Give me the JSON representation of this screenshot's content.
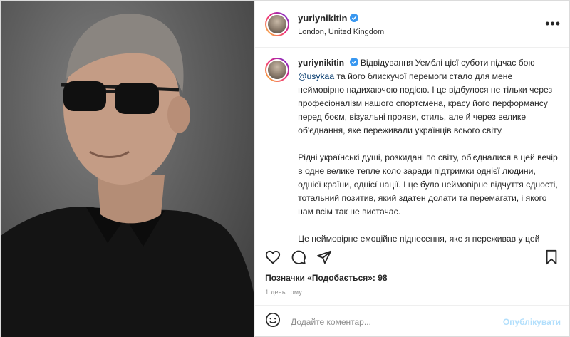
{
  "post": {
    "username": "yuriynikitin",
    "location": "London, United Kingdom",
    "more_label": "•••",
    "caption": {
      "text_1": "Відвідування Уемблі цієї суботи підчас бою",
      "mention": "@usykaa",
      "text_2": "та його блискучої перемоги стало для мене неймовірно надихаючою подією. І це відбулося не тільки через професіоналізм нашого спортсмена, красу його перформансу перед боєм, візуальні прояви, стиль, але й через велике об'єднання, яке переживали українців всього світу.",
      "para_2": "Рідні українські душі, розкидані по світу, об'єдналися в цей вечір в одне велике тепле коло заради підтримки однієї людини, однієї країни, однієї нації. І це було неймовірне відчуття єдності, тотальний позитив, який здатен долати та перемагати, і якого нам всім так не вистачає.",
      "para_3": "Це неймовірне емоційне піднесення, яке я переживав у цей вечір народило у мені велике бажання зробити наймаштабніший, всесвітньо відомий український музичний"
    },
    "likes_text": "Позначки «Подобається»: 98",
    "timestamp": "1 день тому",
    "comment": {
      "placeholder": "Додайте коментар...",
      "publish_label": "Опублікувати"
    },
    "icons": [
      "heart-icon",
      "comment-icon",
      "share-icon",
      "bookmark-icon",
      "emoji-icon",
      "verified-icon",
      "more-icon"
    ],
    "colors": {
      "verified": "#3897f0",
      "mention": "#00376b",
      "publish": "#b2dffc",
      "muted": "#8e8e8e"
    }
  }
}
